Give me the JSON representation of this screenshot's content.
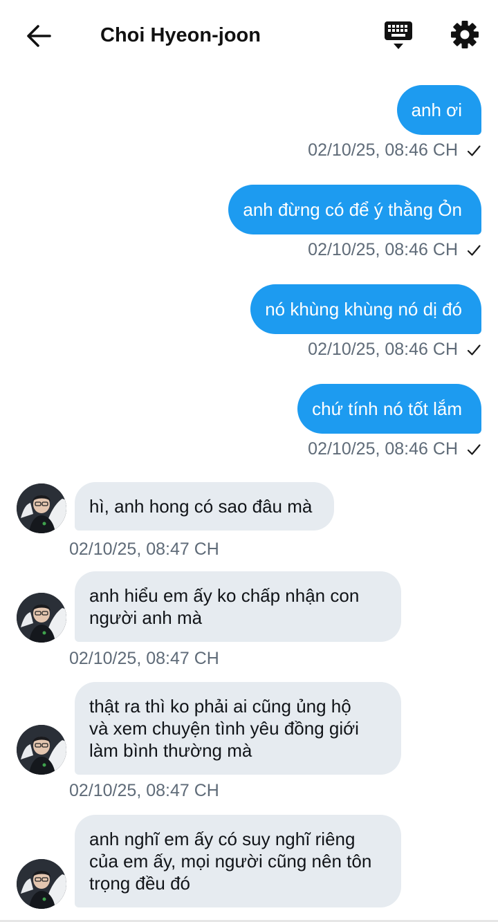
{
  "header": {
    "title": "Choi Hyeon-joon",
    "back_icon": "arrow-left-icon",
    "keyboard_icon": "keyboard-icon",
    "settings_icon": "gear-icon"
  },
  "colors": {
    "outgoing_bubble": "#1d9bf0",
    "incoming_bubble": "#e6ebf0",
    "timestamp": "#5f6b78"
  },
  "messages": [
    {
      "direction": "out",
      "text": "anh ơi",
      "time": "02/10/25, 08:46 CH",
      "status": "check-icon"
    },
    {
      "direction": "out",
      "text": "anh đừng có để ý thằng Ỏn",
      "time": "02/10/25, 08:46 CH",
      "status": "check-icon"
    },
    {
      "direction": "out",
      "text": "nó khùng khùng nó dị đó",
      "time": "02/10/25, 08:46 CH",
      "status": "check-icon"
    },
    {
      "direction": "out",
      "text": "chứ tính nó tốt lắm",
      "time": "02/10/25, 08:46 CH",
      "status": "check-icon"
    },
    {
      "direction": "in",
      "lines": [
        "hì, anh hong có sao đâu mà"
      ],
      "time": "02/10/25, 08:47 CH"
    },
    {
      "direction": "in",
      "lines": [
        "anh hiểu em ấy ko chấp nhận con",
        "người anh mà"
      ],
      "time": "02/10/25, 08:47 CH"
    },
    {
      "direction": "in",
      "lines": [
        "thật ra thì ko phải ai cũng ủng hộ",
        "và xem chuyện tình yêu đồng giới",
        "làm bình thường mà"
      ],
      "time": "02/10/25, 08:47 CH"
    },
    {
      "direction": "in",
      "lines": [
        "anh nghĩ em ấy có suy nghĩ riêng",
        "của em ấy, mọi người cũng nên tôn",
        "trọng đều đó"
      ],
      "time": ""
    }
  ]
}
